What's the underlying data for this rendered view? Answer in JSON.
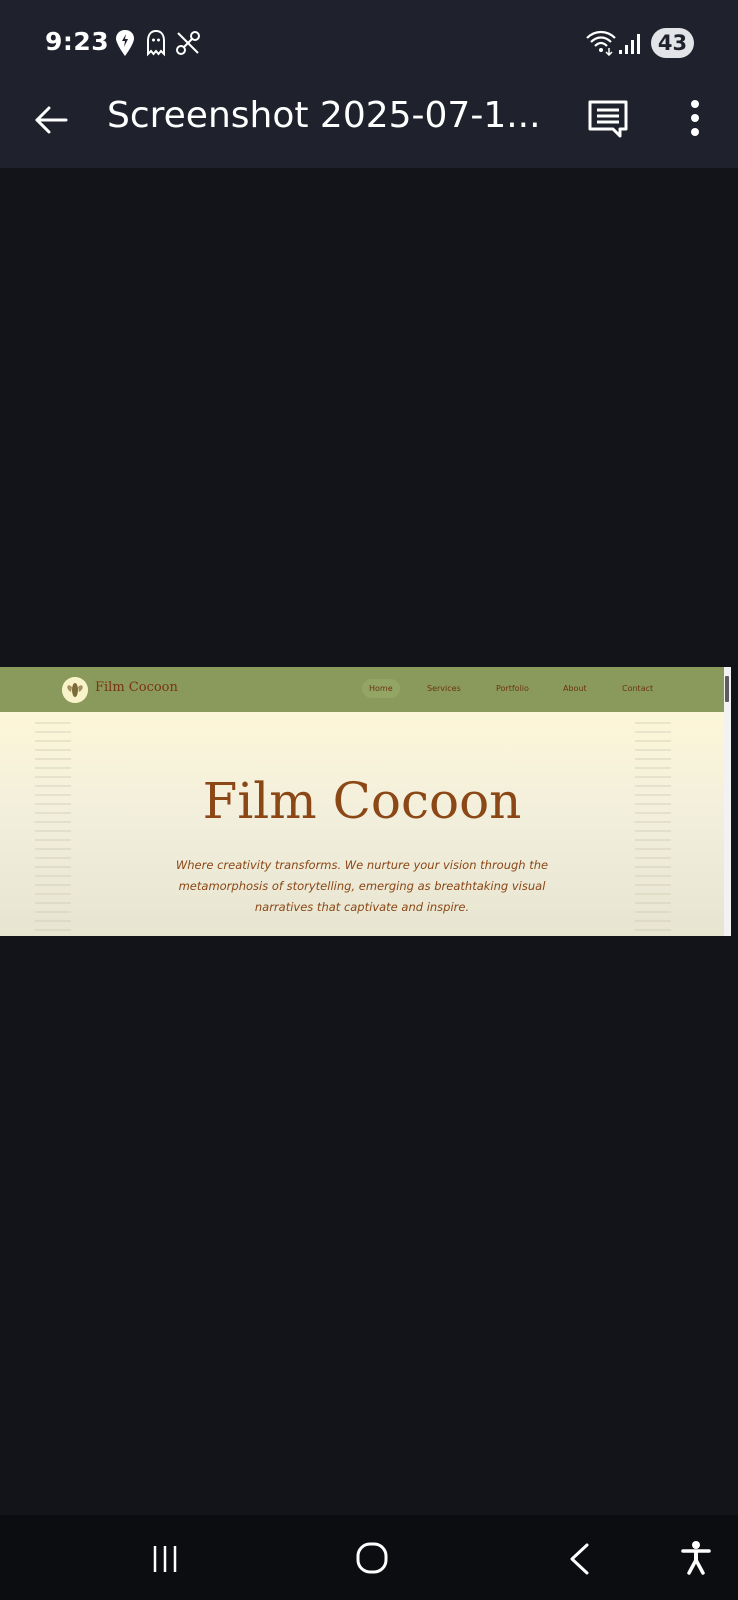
{
  "status_bar": {
    "time": "9:23",
    "battery_level": "43",
    "icons": [
      "location-pin-icon",
      "ghost-notification-icon",
      "vpn-off-icon",
      "wifi-icon",
      "signal-icon"
    ]
  },
  "app_bar": {
    "title": "Screenshot 2025-07-1...",
    "icons": [
      "back-arrow-icon",
      "comment-icon",
      "more-vert-icon"
    ]
  },
  "website": {
    "brand": "Film Cocoon",
    "nav_links": [
      "Home",
      "Services",
      "Portfolio",
      "About",
      "Contact"
    ],
    "hero_title": "Film Cocoon",
    "hero_tagline": "Where creativity transforms. We nurture your vision through the metamorphosis of storytelling, emerging as breathtaking visual narratives that captivate and inspire.",
    "colors": {
      "nav_background": "#8a9a5c",
      "accent_brown": "#8b4716",
      "hero_background": "#fdf6d8"
    }
  },
  "nav_bar": {
    "icons": [
      "recent-apps-icon",
      "home-icon",
      "back-icon",
      "accessibility-icon"
    ]
  },
  "colors": {
    "app_bar_background": "#1f222c",
    "viewer_background": "#131419"
  }
}
